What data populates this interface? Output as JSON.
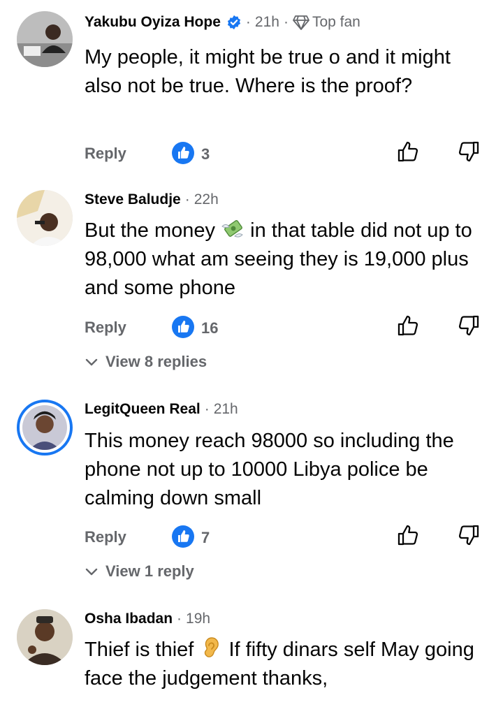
{
  "comments": [
    {
      "name": "Yakubu Oyiza Hope",
      "verified": true,
      "time": "21h",
      "badge": "Top fan",
      "text": "My people, it might be true o and it might also not be true. Where is the proof?",
      "reply_label": "Reply",
      "likes": "3"
    },
    {
      "name": "Steve Baludje",
      "time": "22h",
      "text_before": "But the money ",
      "emoji": "money-with-wings",
      "text_after": " in that table did not up to 98,000 what am seeing they is 19,000 plus and some phone",
      "reply_label": "Reply",
      "likes": "16",
      "view_replies": "View 8 replies"
    },
    {
      "name": "LegitQueen Real",
      "time": "21h",
      "text": "This money reach 98000 so including the phone not up to 10000 Libya police be calming down small",
      "reply_label": "Reply",
      "likes": "7",
      "view_replies": "View 1 reply"
    },
    {
      "name": "Osha Ibadan",
      "time": "19h",
      "text_before": "Thief is thief ",
      "emoji": "ear",
      "text_after": " If fifty dinars self  May going face the judgement  thanks,"
    }
  ],
  "colors": {
    "primary_text": "#050505",
    "secondary_text": "#65676b",
    "like_blue": "#1877f2"
  }
}
